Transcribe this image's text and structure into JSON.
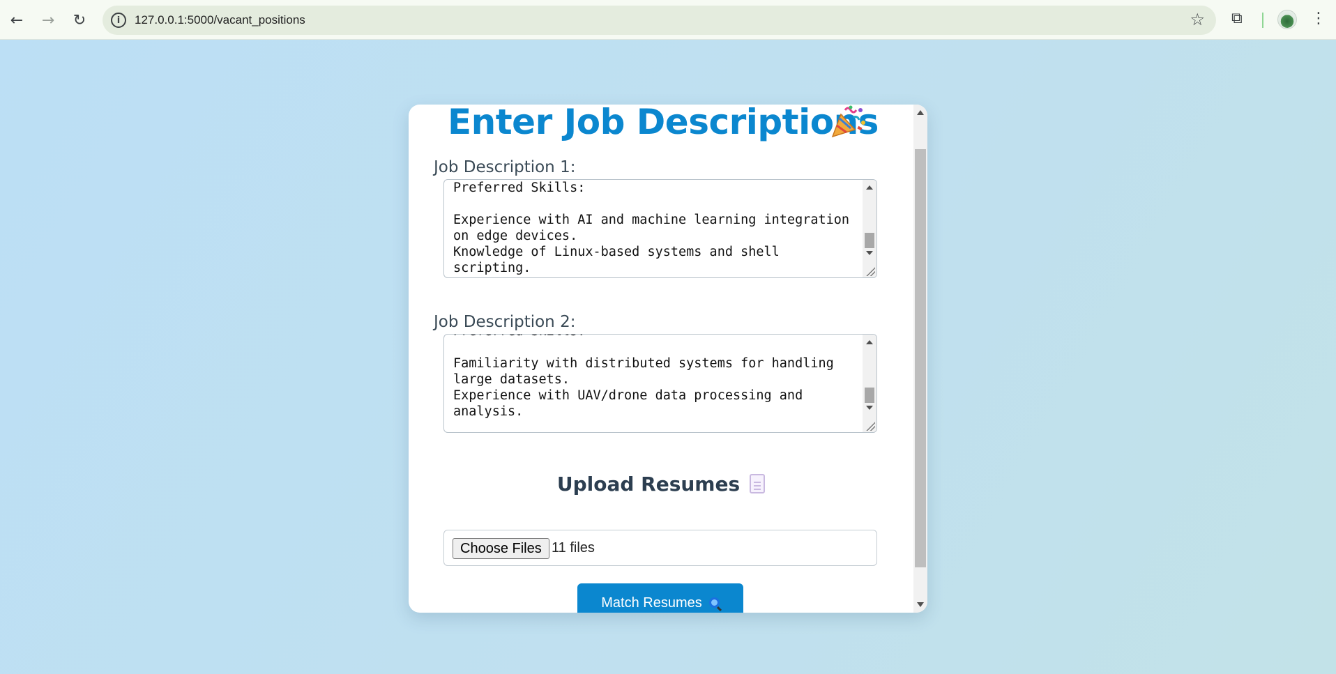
{
  "browser": {
    "url": "127.0.0.1:5000/vacant_positions",
    "back_icon": "←",
    "forward_icon": "→",
    "reload_icon": "↻",
    "info_icon": "i",
    "bookmark_icon": "☆",
    "extensions_icon": "⧉",
    "menu_icon": "⋮"
  },
  "page": {
    "title": "Enter Job Descriptions",
    "title_color": "#0b87cf",
    "job_descriptions": [
      {
        "label": "Job Description 1:",
        "text": "Preferred Skills:\n\nExperience with AI and machine learning integration\non edge devices.\nKnowledge of Linux-based systems and shell\nscripting."
      },
      {
        "label": "Job Description 2:",
        "text": "Preferred Skills:\n\nFamiliarity with distributed systems for handling\nlarge datasets.\nExperience with UAV/drone data processing and\nanalysis."
      }
    ],
    "upload_title": "Upload Resumes",
    "choose_files_label": "Choose Files",
    "file_status": "11 files",
    "match_button_label": "Match Resumes",
    "accent_color": "#0b87cf"
  }
}
